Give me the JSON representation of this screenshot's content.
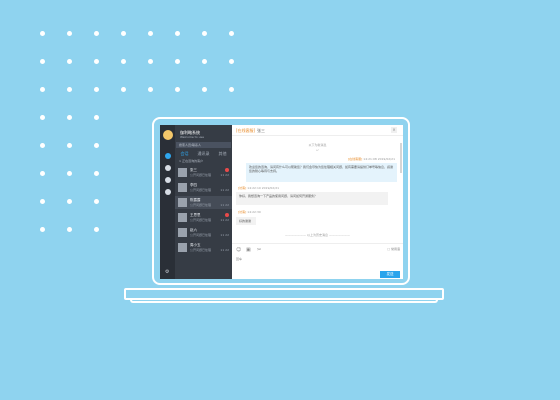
{
  "sidebar": {
    "header_name": "伽利略系统",
    "header_sub": "Welcome to use",
    "search_placeholder": "搜索人员/联系人",
    "tabs": [
      "会话",
      "通讯录",
      "其他"
    ],
    "group_label": "∨ 正在咨询的客户",
    "bottom_icon": "gear-icon"
  },
  "contacts": [
    {
      "name": "张三 ",
      "sub": "公开问题已处理",
      "meta": "11  22",
      "badge": true
    },
    {
      "name": "李四 ",
      "sub": "公开问题已处理",
      "meta": "11  22",
      "badge": false
    },
    {
      "name": "陈露露 ",
      "sub": "公开问题已处理",
      "meta": "11  22",
      "badge": false
    },
    {
      "name": "王思思 ",
      "sub": "公开问题已处理",
      "meta": "11  22",
      "badge": true
    },
    {
      "name": "赵六",
      "sub": "公开问题已处理",
      "meta": "11  22",
      "badge": false
    },
    {
      "name": "周小玉 ",
      "sub": "公开问题已处理",
      "meta": "11  22",
      "badge": false
    }
  ],
  "chat": {
    "title_tag": "[在线客服]",
    "title_name": "张三",
    "close_glyph": "×",
    "sep1": "以下为新消息",
    "sep1_glyph": "↵",
    "msg1_meta_name": "[在线客服]",
    "msg1_meta_time": " 14:21:08 2019/02/21",
    "msg1_text": "欢迎您的咨询，请问有什么可以帮助您？我们会尽快为您处理相关问题，如有需要请提供订单号等信息，感谢您的耐心等待与支持。",
    "msg2_meta_name": "[访客]",
    "msg2_meta_time": " 14:22:10 2019/02/21",
    "msg2_text": "你好，我想咨询一下产品的使用问题，请问如何开通服务？",
    "msg3_meta_name": "[访客]",
    "msg3_meta_time": " 14:22:30",
    "msg3_text": "好的谢谢",
    "sep2": "———————  以上为历史消息  ———————",
    "composer_right": "□ 常用语",
    "composer_hint": "回车",
    "send_label": "发送"
  },
  "colors": {
    "background": "#8fd3ef",
    "rail": "#2a2f37",
    "list": "#363c45",
    "accent": "#29a4ec",
    "orange": "#e88d2d",
    "badge": "#e84a4a"
  }
}
